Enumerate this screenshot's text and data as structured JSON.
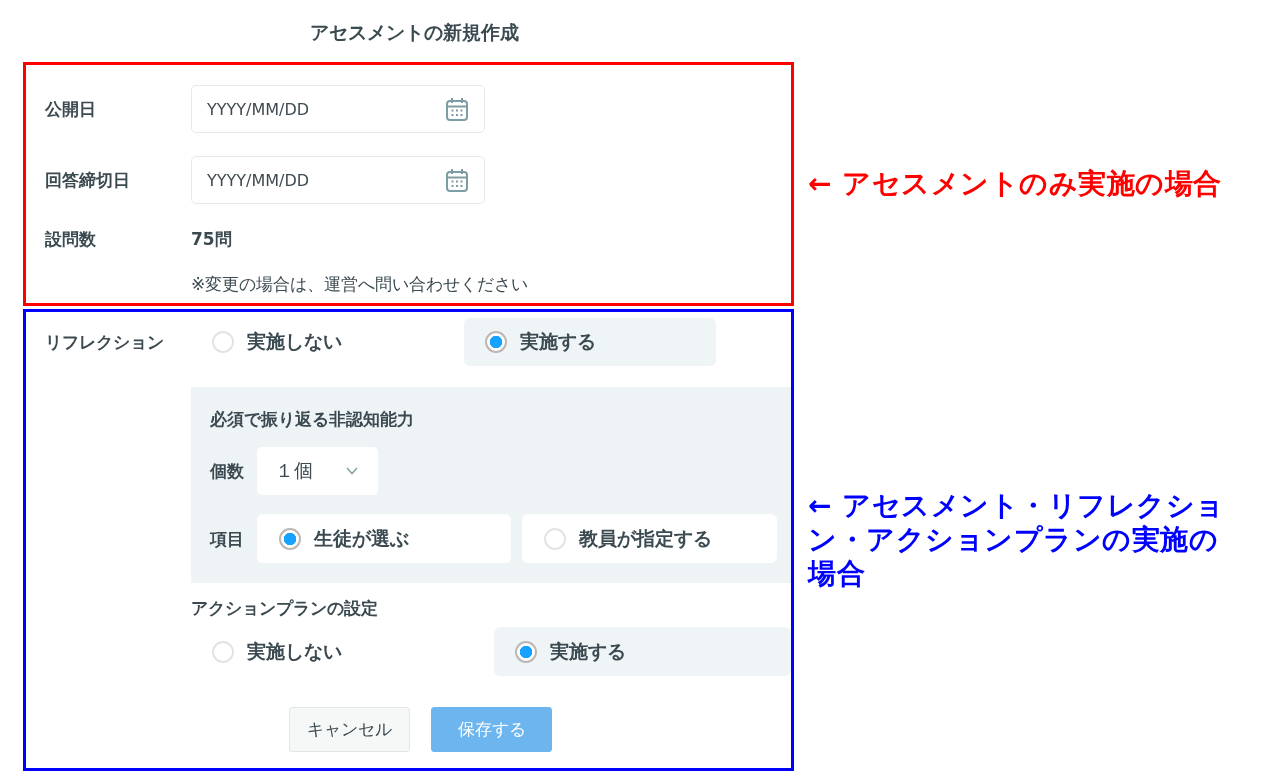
{
  "title": "アセスメントの新規作成",
  "assessment_section": {
    "highlight": {
      "color": "#ff0000",
      "note": "← アセスメントのみ実施の場合"
    },
    "fields": [
      {
        "kind": "date",
        "label": "公開日",
        "placeholder": "YYYY/MM/DD"
      },
      {
        "kind": "date",
        "label": "回答締切日",
        "placeholder": "YYYY/MM/DD"
      },
      {
        "kind": "static",
        "label": "設問数",
        "value": "75問"
      }
    ],
    "note": "※変更の場合は、運営へ問い合わせください"
  },
  "reflection_section": {
    "highlight": {
      "color": "#0000ff",
      "note": "← アセスメント・リフレクション・アクションプランの実施の場合"
    },
    "reflection": {
      "label": "リフレクション",
      "options": [
        {
          "label": "実施しない",
          "selected": false
        },
        {
          "label": "実施する",
          "selected": true
        }
      ]
    },
    "required_skills": {
      "title": "必須で振り返る非認知能力",
      "count": {
        "label": "個数",
        "value": "１個"
      },
      "items": {
        "label": "項目",
        "options": [
          {
            "label": "生徒が選ぶ",
            "selected": true
          },
          {
            "label": "教員が指定する",
            "selected": false
          }
        ]
      }
    },
    "action_plan": {
      "title": "アクションプランの設定",
      "options": [
        {
          "label": "実施しない",
          "selected": false
        },
        {
          "label": "実施する",
          "selected": true
        }
      ]
    },
    "buttons": [
      {
        "kind": "cancel",
        "label": "キャンセル",
        "disabled": false
      },
      {
        "kind": "save",
        "label": "保存する",
        "disabled": true
      }
    ]
  }
}
